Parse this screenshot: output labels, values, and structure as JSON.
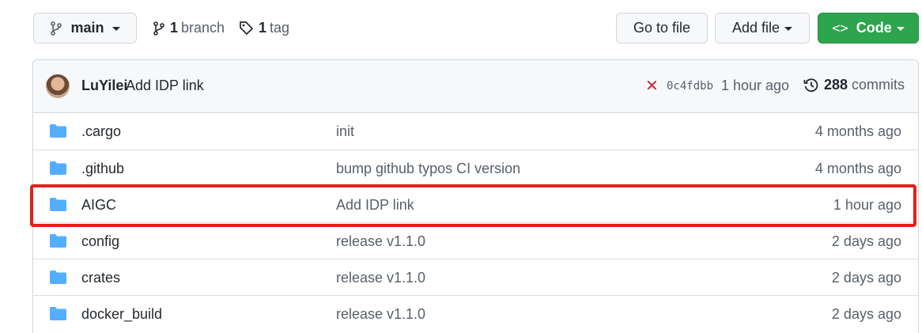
{
  "toolbar": {
    "branch_label": "main",
    "branches_count": "1",
    "branches_label": "branch",
    "tags_count": "1",
    "tags_label": "tag",
    "go_to_file": "Go to file",
    "add_file": "Add file",
    "code": "Code"
  },
  "commit": {
    "author": "LuYilei",
    "message": "Add IDP link",
    "status": "failed",
    "status_glyph": "✕",
    "sha": "0c4fdbb",
    "time": "1 hour ago",
    "commit_count": "288",
    "commits_label": "commits"
  },
  "files": [
    {
      "name": ".cargo",
      "message": "init",
      "age": "4 months ago",
      "type": "folder"
    },
    {
      "name": ".github",
      "message": "bump github typos CI version",
      "age": "4 months ago",
      "type": "folder"
    },
    {
      "name": "AIGC",
      "message": "Add IDP link",
      "age": "1 hour ago",
      "type": "folder",
      "highlighted": true
    },
    {
      "name": "config",
      "message": "release v1.1.0",
      "age": "2 days ago",
      "type": "folder"
    },
    {
      "name": "crates",
      "message": "release v1.1.0",
      "age": "2 days ago",
      "type": "folder"
    },
    {
      "name": "docker_build",
      "message": "release v1.1.0",
      "age": "2 days ago",
      "type": "folder"
    }
  ],
  "colors": {
    "folder": "#54aeff",
    "highlight": "#e0221b",
    "code_button": "#2da44e",
    "status_fail": "#cf222e"
  },
  "icons": {
    "branch": "git-branch-icon",
    "tag": "tag-icon",
    "code": "code-icon",
    "history": "history-icon",
    "folder": "folder-icon"
  }
}
